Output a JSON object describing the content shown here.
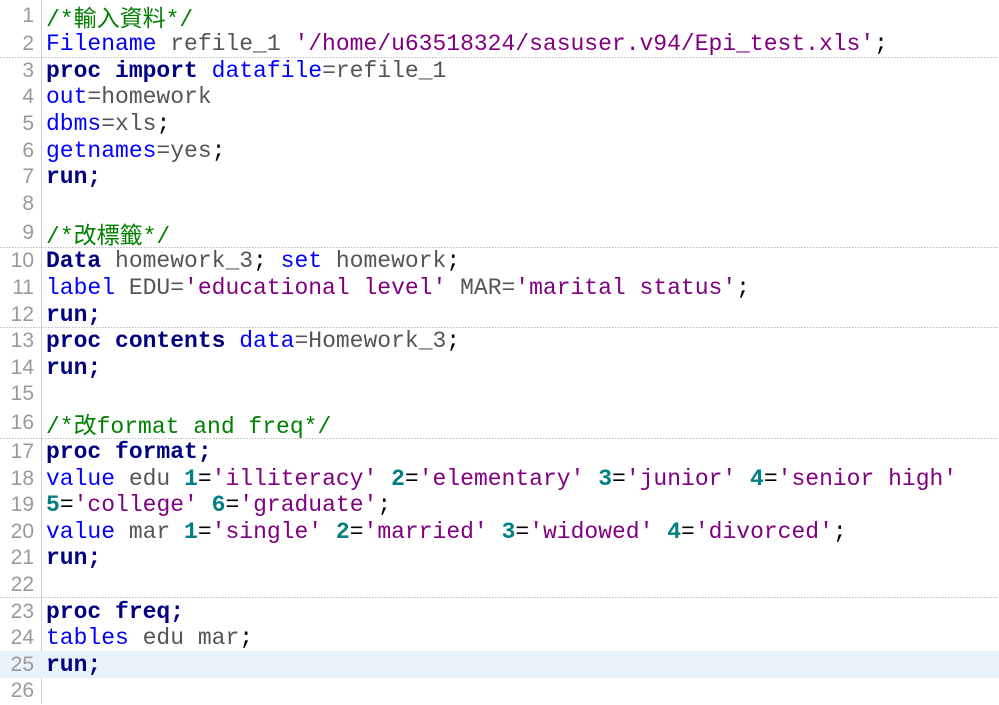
{
  "editor": {
    "current_line": 25,
    "lines": [
      {
        "n": "1",
        "tokens": [
          [
            "cm",
            "/*輸入資料*/"
          ]
        ]
      },
      {
        "n": "2",
        "tokens": [
          [
            "bl",
            "Filename"
          ],
          [
            "tx",
            " refile_1 "
          ],
          [
            "st",
            "'/home/u63518324/sasuser.v94/Epi_test.xls'"
          ],
          [
            "pu",
            ";"
          ]
        ]
      },
      {
        "n": "3",
        "tokens": [
          [
            "kw",
            "proc import"
          ],
          [
            "tx",
            " "
          ],
          [
            "bl",
            "datafile"
          ],
          [
            "tx",
            "=refile_1"
          ]
        ]
      },
      {
        "n": "4",
        "tokens": [
          [
            "bl",
            "out"
          ],
          [
            "tx",
            "=homework"
          ]
        ]
      },
      {
        "n": "5",
        "tokens": [
          [
            "bl",
            "dbms"
          ],
          [
            "tx",
            "=xls"
          ],
          [
            "pu",
            ";"
          ]
        ]
      },
      {
        "n": "6",
        "tokens": [
          [
            "bl",
            "getnames"
          ],
          [
            "tx",
            "=yes"
          ],
          [
            "pu",
            ";"
          ]
        ]
      },
      {
        "n": "7",
        "tokens": [
          [
            "kw",
            "run;"
          ]
        ]
      },
      {
        "n": "8",
        "tokens": []
      },
      {
        "n": "9",
        "tokens": [
          [
            "cm",
            "/*改標籤*/"
          ]
        ]
      },
      {
        "n": "10",
        "tokens": [
          [
            "kw",
            "Data"
          ],
          [
            "tx",
            " homework_3"
          ],
          [
            "pu",
            "; "
          ],
          [
            "bl",
            "set"
          ],
          [
            "tx",
            " homework"
          ],
          [
            "pu",
            ";"
          ]
        ]
      },
      {
        "n": "11",
        "tokens": [
          [
            "bl",
            "label"
          ],
          [
            "tx",
            " EDU="
          ],
          [
            "st",
            "'educational level'"
          ],
          [
            "tx",
            " MAR="
          ],
          [
            "st",
            "'marital status'"
          ],
          [
            "pu",
            ";"
          ]
        ]
      },
      {
        "n": "12",
        "tokens": [
          [
            "kw",
            "run;"
          ]
        ]
      },
      {
        "n": "13",
        "tokens": [
          [
            "kw",
            "proc contents"
          ],
          [
            "tx",
            " "
          ],
          [
            "bl",
            "data"
          ],
          [
            "tx",
            "=Homework_3"
          ],
          [
            "pu",
            ";"
          ]
        ]
      },
      {
        "n": "14",
        "tokens": [
          [
            "kw",
            "run;"
          ]
        ]
      },
      {
        "n": "15",
        "tokens": []
      },
      {
        "n": "16",
        "tokens": [
          [
            "cm",
            "/*改format and freq*/"
          ]
        ]
      },
      {
        "n": "17",
        "tokens": [
          [
            "kw",
            "proc format;"
          ]
        ]
      },
      {
        "n": "18",
        "tokens": [
          [
            "bl",
            "value"
          ],
          [
            "tx",
            " edu "
          ],
          [
            "nu",
            "1"
          ],
          [
            "pu",
            "="
          ],
          [
            "st",
            "'illiteracy'"
          ],
          [
            "tx",
            " "
          ],
          [
            "nu",
            "2"
          ],
          [
            "pu",
            "="
          ],
          [
            "st",
            "'elementary'"
          ],
          [
            "tx",
            " "
          ],
          [
            "nu",
            "3"
          ],
          [
            "pu",
            "="
          ],
          [
            "st",
            "'junior'"
          ],
          [
            "tx",
            " "
          ],
          [
            "nu",
            "4"
          ],
          [
            "pu",
            "="
          ],
          [
            "st",
            "'senior high'"
          ]
        ]
      },
      {
        "n": "19",
        "tokens": [
          [
            "nu",
            "5"
          ],
          [
            "pu",
            "="
          ],
          [
            "st",
            "'college'"
          ],
          [
            "tx",
            " "
          ],
          [
            "nu",
            "6"
          ],
          [
            "pu",
            "="
          ],
          [
            "st",
            "'graduate'"
          ],
          [
            "pu",
            ";"
          ]
        ]
      },
      {
        "n": "20",
        "tokens": [
          [
            "bl",
            "value"
          ],
          [
            "tx",
            " mar "
          ],
          [
            "nu",
            "1"
          ],
          [
            "pu",
            "="
          ],
          [
            "st",
            "'single'"
          ],
          [
            "tx",
            " "
          ],
          [
            "nu",
            "2"
          ],
          [
            "pu",
            "="
          ],
          [
            "st",
            "'married'"
          ],
          [
            "tx",
            " "
          ],
          [
            "nu",
            "3"
          ],
          [
            "pu",
            "="
          ],
          [
            "st",
            "'widowed'"
          ],
          [
            "tx",
            " "
          ],
          [
            "nu",
            "4"
          ],
          [
            "pu",
            "="
          ],
          [
            "st",
            "'divorced'"
          ],
          [
            "pu",
            ";"
          ]
        ]
      },
      {
        "n": "21",
        "tokens": [
          [
            "kw",
            "run;"
          ]
        ]
      },
      {
        "n": "22",
        "tokens": []
      },
      {
        "n": "23",
        "tokens": [
          [
            "kw",
            "proc freq;"
          ]
        ]
      },
      {
        "n": "24",
        "tokens": [
          [
            "bl",
            "tables"
          ],
          [
            "tx",
            " edu mar"
          ],
          [
            "pu",
            ";"
          ]
        ]
      },
      {
        "n": "25",
        "tokens": [
          [
            "kw",
            "run;"
          ]
        ]
      },
      {
        "n": "26",
        "tokens": []
      }
    ]
  }
}
